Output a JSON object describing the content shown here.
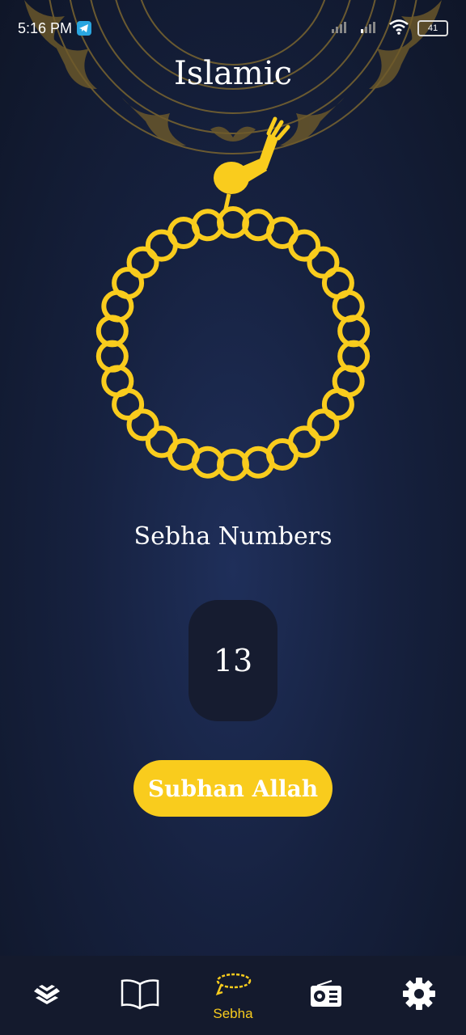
{
  "status_bar": {
    "time": "5:16 PM",
    "battery": "41"
  },
  "header": {
    "title": "Islamic"
  },
  "sebha": {
    "label": "Sebha Numbers",
    "count": "13",
    "button_label": "Subhan Allah"
  },
  "bottom_nav": {
    "items": [
      {
        "icon": "quran-icon",
        "label": ""
      },
      {
        "icon": "book-icon",
        "label": ""
      },
      {
        "icon": "sebha-icon",
        "label": "Sebha",
        "active": true
      },
      {
        "icon": "radio-icon",
        "label": ""
      },
      {
        "icon": "gear-icon",
        "label": ""
      }
    ]
  },
  "colors": {
    "accent": "#f9cc1d",
    "background": "#16213f",
    "nav_background": "#141a2d",
    "counter_background": "#161c30"
  }
}
